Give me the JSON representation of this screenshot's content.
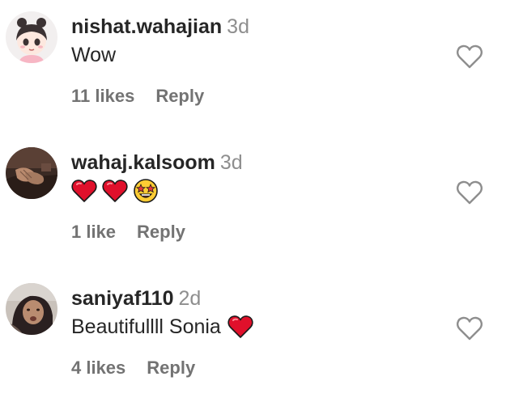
{
  "comments": [
    {
      "username": "nishat.wahajian",
      "time": "3d",
      "text": "Wow",
      "emojis": [],
      "likes": "11 likes",
      "reply": "Reply",
      "avatar_icon": "cartoon-girl-avatar"
    },
    {
      "username": "wahaj.kalsoom",
      "time": "3d",
      "text": "",
      "emojis": [
        "red-heart",
        "red-heart",
        "star-struck"
      ],
      "likes": "1 like",
      "reply": "Reply",
      "avatar_icon": "hands-photo-avatar"
    },
    {
      "username": "saniyaf110",
      "time": "2d",
      "text": "Beautifullll Sonia",
      "emojis": [
        "red-heart"
      ],
      "likes": "4 likes",
      "reply": "Reply",
      "avatar_icon": "woman-photo-avatar"
    }
  ],
  "colors": {
    "username": "#262626",
    "secondary": "#8e8e8e",
    "meta": "#737373",
    "heart_red": "#e0102b",
    "heart_outline": "#8e8e8e"
  }
}
